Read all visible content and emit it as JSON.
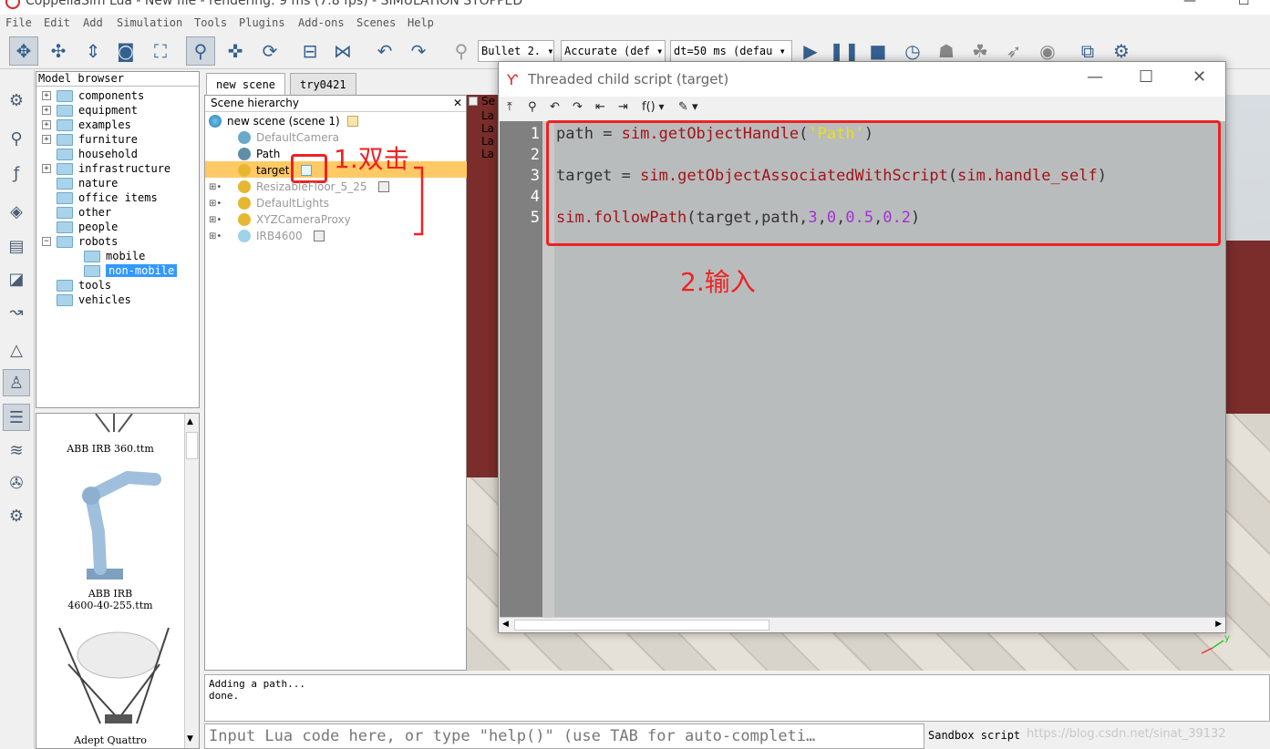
{
  "window": {
    "title": "CoppeliaSim Lua - New file - rendering: 9 ms (7.8 fps) - SIMULATION STOPPED",
    "min": "—",
    "max": "☐"
  },
  "menu": [
    "File",
    "Edit",
    "Add",
    "Simulation",
    "Tools",
    "Plugins",
    "Add-ons",
    "Scenes",
    "Help"
  ],
  "toolbar": {
    "engine": "Bullet 2.",
    "accuracy": "Accurate (def",
    "timestep": "dt=50 ms (defau"
  },
  "model_browser": {
    "header": "Model browser",
    "items": [
      {
        "label": "components",
        "expandable": true,
        "level": 0
      },
      {
        "label": "equipment",
        "expandable": true,
        "level": 0
      },
      {
        "label": "examples",
        "expandable": true,
        "level": 0
      },
      {
        "label": "furniture",
        "expandable": true,
        "level": 0
      },
      {
        "label": "household",
        "expandable": false,
        "level": 0
      },
      {
        "label": "infrastructure",
        "expandable": true,
        "level": 0
      },
      {
        "label": "nature",
        "expandable": false,
        "level": 0
      },
      {
        "label": "office items",
        "expandable": false,
        "level": 0
      },
      {
        "label": "other",
        "expandable": false,
        "level": 0
      },
      {
        "label": "people",
        "expandable": false,
        "level": 0
      },
      {
        "label": "robots",
        "expandable": true,
        "level": 0
      },
      {
        "label": "mobile",
        "expandable": false,
        "level": 1
      },
      {
        "label": "non-mobile",
        "expandable": false,
        "level": 1
      },
      {
        "label": "tools",
        "expandable": false,
        "level": 0
      },
      {
        "label": "vehicles",
        "expandable": false,
        "level": 0
      }
    ],
    "thumbnails": [
      "ABB IRB 360.ttm",
      "ABB IRB",
      "4600-40-255.ttm",
      "Adept Quattro"
    ]
  },
  "scene_tabs": [
    "new scene",
    "try0421"
  ],
  "scene_hierarchy": {
    "header": "Scene hierarchy",
    "close": "✕",
    "root": "new scene (scene 1)",
    "items": [
      {
        "label": "DefaultCamera",
        "dim": true
      },
      {
        "label": "Path",
        "dim": false
      },
      {
        "label": "target",
        "dim": false
      },
      {
        "label": "ResizableFloor_5_25",
        "dim": true
      },
      {
        "label": "DefaultLights",
        "dim": true
      },
      {
        "label": "XYZCameraProxy",
        "dim": true
      },
      {
        "label": "IRB4600",
        "dim": true
      }
    ]
  },
  "viewport_side": [
    "Se",
    "La",
    "La",
    "La",
    "La"
  ],
  "editor": {
    "title": "Threaded child script (target)",
    "func_menu": "f()",
    "lines": [
      "1",
      "2",
      "3",
      "4",
      "5"
    ],
    "code": {
      "l1_var": "path",
      "l1_eq": " = ",
      "l1_fn": "sim.getObjectHandle",
      "l1_open": "(",
      "l1_str": "'Path'",
      "l1_close": ")",
      "l3_var": "target",
      "l3_eq": " = ",
      "l3_fn": "sim.getObjectAssociatedWithScript",
      "l3_open": "(",
      "l3_arg": "sim.handle_self",
      "l3_close": ")",
      "l5_fn": "sim.followPath",
      "l5_open": "(target,path,",
      "l5_n1": "3",
      "l5_c1": ",",
      "l5_n2": "0",
      "l5_c2": ",",
      "l5_n3": "0.5",
      "l5_c3": ",",
      "l5_n4": "0.2",
      "l5_close": ")"
    }
  },
  "annotations": {
    "step1": "1.双击",
    "step2": "2.输入"
  },
  "console": {
    "line1": "Adding a path...",
    "line2": "done."
  },
  "lua_input": {
    "placeholder": "Input Lua code here, or type \"help()\" (use TAB for auto-completi…"
  },
  "sandbox": {
    "label": "Sandbox script",
    "watermark": "https://blog.csdn.net/sinat_39132"
  }
}
